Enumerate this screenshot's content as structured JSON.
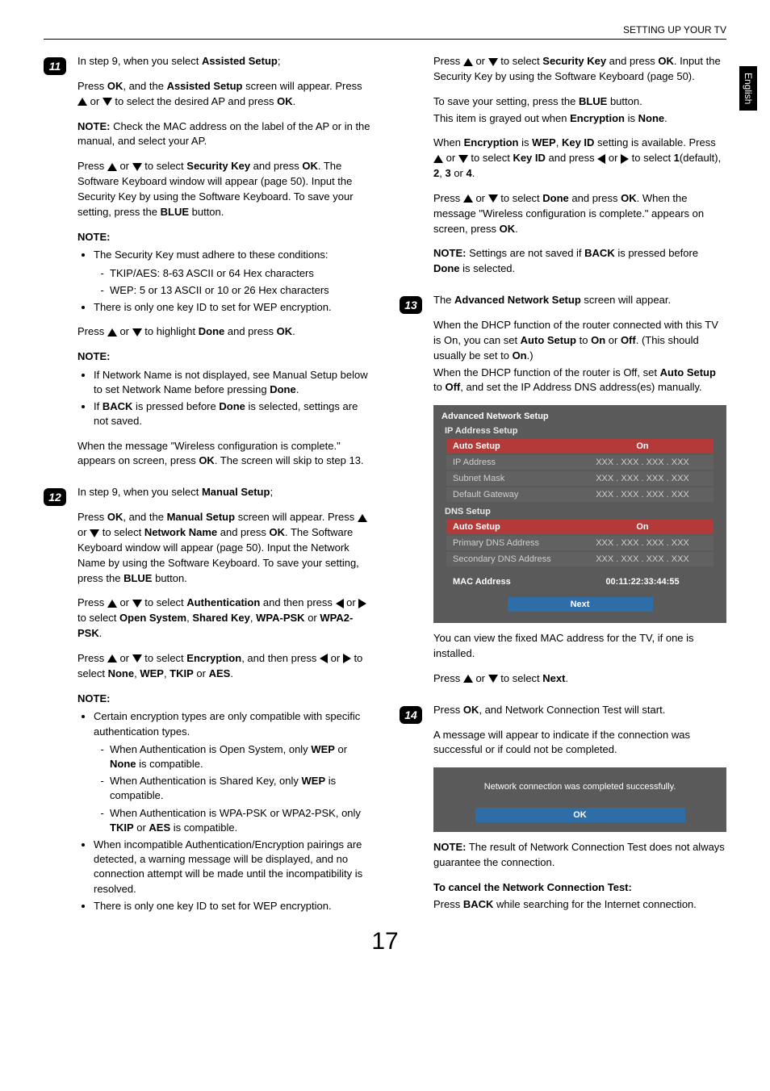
{
  "header": "SETTING UP YOUR TV",
  "sideTab": "English",
  "pageNumber": "17",
  "step11": {
    "badge": "11",
    "p1a": "In step 9, when you select ",
    "p1b": "Assisted Setup",
    "p1c": ";",
    "p2a": "Press ",
    "p2b": "OK",
    "p2c": ", and the ",
    "p2d": "Assisted Setup",
    "p2e": " screen will appear. Press ",
    "p2f": " or ",
    "p2g": " to select the desired AP and press ",
    "p2h": "OK",
    "p2i": ".",
    "p3a": "NOTE:",
    "p3b": " Check the MAC address on the label of the AP or in the manual, and select your AP.",
    "p4a": "Press ",
    "p4b": " or ",
    "p4c": " to select ",
    "p4d": "Security Key",
    "p4e": " and press ",
    "p4f": "OK",
    "p4g": ". The Software Keyboard window will appear (page 50). Input the Security Key by using the Software Keyboard. To save your setting, press the ",
    "p4h": "BLUE",
    "p4i": " button.",
    "note1": "NOTE:",
    "li1": "The Security Key must adhere to these conditions:",
    "li1a": "TKIP/AES: 8-63 ASCII or 64 Hex characters",
    "li1b": "WEP: 5 or 13 ASCII or 10 or 26 Hex characters",
    "li2": "There is only one key ID to set for WEP encryption.",
    "p5a": "Press ",
    "p5b": " or ",
    "p5c": " to highlight ",
    "p5d": "Done",
    "p5e": " and press ",
    "p5f": "OK",
    "p5g": ".",
    "note2": "NOTE:",
    "li3a": "If Network Name is not displayed, see Manual Setup below to set Network Name before pressing ",
    "li3b": "Done",
    "li3c": ".",
    "li4a": "If ",
    "li4b": "BACK",
    "li4c": " is pressed before ",
    "li4d": "Done",
    "li4e": " is selected, settings are not saved.",
    "p6a": "When the message \"Wireless configuration is complete.\" appears on screen, press ",
    "p6b": "OK",
    "p6c": ". The screen will skip to step 13."
  },
  "step12": {
    "badge": "12",
    "p1a": "In step 9, when you select ",
    "p1b": "Manual Setup",
    "p1c": ";",
    "p2a": "Press ",
    "p2b": "OK",
    "p2c": ", and the ",
    "p2d": "Manual Setup",
    "p2e": " screen will appear. Press ",
    "p2f": " or ",
    "p2g": " to select ",
    "p2h": "Network Name",
    "p2i": " and press ",
    "p2j": "OK",
    "p2k": ". The Software Keyboard window will appear (page 50). Input the Network Name by using the Software Keyboard. To save your setting, press the ",
    "p2l": "BLUE",
    "p2m": " button.",
    "p3a": "Press ",
    "p3b": " or ",
    "p3c": " to select ",
    "p3d": "Authentication",
    "p3e": " and then press ",
    "p3f": " or ",
    "p3g": " to select ",
    "p3h": "Open System",
    "p3i": ", ",
    "p3j": "Shared Key",
    "p3k": ", ",
    "p3l": "WPA-PSK",
    "p3m": " or ",
    "p3n": "WPA2-PSK",
    "p3o": ".",
    "p4a": "Press ",
    "p4b": " or ",
    "p4c": " to select ",
    "p4d": "Encryption",
    "p4e": ", and then press ",
    "p4f": " or ",
    "p4g": " to select ",
    "p4h": "None",
    "p4i": ", ",
    "p4j": "WEP",
    "p4k": ", ",
    "p4l": "TKIP",
    "p4m": " or ",
    "p4n": "AES",
    "p4o": ".",
    "note1": "NOTE:",
    "li1": "Certain encryption types are only compatible with specific authentication types.",
    "li1aA": "When Authentication is Open System, only ",
    "li1aB": "WEP",
    "li1aC": " or ",
    "li1aD": "None",
    "li1aE": " is compatible.",
    "li1bA": "When Authentication is Shared Key, only ",
    "li1bB": "WEP",
    "li1bC": " is compatible.",
    "li1cA": "When Authentication is WPA-PSK or WPA2-PSK, only ",
    "li1cB": "TKIP",
    "li1cC": " or ",
    "li1cD": "AES",
    "li1cE": " is compatible.",
    "li2": "When incompatible Authentication/Encryption pairings are detected, a warning message will be displayed, and no connection attempt will be made until the incompatibility is resolved.",
    "li3": "There is only one key ID to set for WEP encryption."
  },
  "col2top": {
    "p1a": "Press ",
    "p1b": " or ",
    "p1c": " to select ",
    "p1d": "Security Key",
    "p1e": " and press ",
    "p1f": "OK",
    "p1g": ". Input the Security Key by using the Software Keyboard (page 50).",
    "p2a": "To save your setting, press the ",
    "p2b": "BLUE",
    "p2c": " button.",
    "p3a": "This item is grayed out when ",
    "p3b": "Encryption",
    "p3c": " is ",
    "p3d": "None",
    "p3e": ".",
    "p4a": "When ",
    "p4b": "Encryption",
    "p4c": " is ",
    "p4d": "WEP",
    "p4e": ", ",
    "p4f": "Key ID",
    "p4g": " setting is available. Press ",
    "p4h": " or ",
    "p4i": " to select ",
    "p4j": "Key ID",
    "p4k": " and press ",
    "p4l": " or ",
    "p4m": " to select ",
    "p4n": "1",
    "p4o": "(default), ",
    "p4p": "2",
    "p4q": ", ",
    "p4r": "3",
    "p4s": " or ",
    "p4t": "4",
    "p4u": ".",
    "p5a": "Press ",
    "p5b": " or ",
    "p5c": " to select ",
    "p5d": "Done",
    "p5e": " and press ",
    "p5f": "OK",
    "p5g": ". When the message \"Wireless configuration is complete.\" appears on screen, press ",
    "p5h": "OK",
    "p5i": ".",
    "p6a": "NOTE:",
    "p6b": " Settings are not saved if ",
    "p6c": "BACK",
    "p6d": " is pressed before ",
    "p6e": "Done",
    "p6f": " is selected."
  },
  "step13": {
    "badge": "13",
    "p1a": "The ",
    "p1b": "Advanced Network Setup",
    "p1c": " screen will appear.",
    "p2a": "When the DHCP function of the router connected with this TV is On, you can set ",
    "p2b": "Auto Setup",
    "p2c": " to ",
    "p2d": "On",
    "p2e": " or ",
    "p2f": "Off",
    "p2g": ". (This should usually be set to ",
    "p2h": "On",
    "p2i": ".)",
    "p3a": "When the DHCP function of the router is Off, set ",
    "p3b": "Auto Setup",
    "p3c": " to ",
    "p3d": "Off",
    "p3e": ", and set the IP Address DNS address(es) manually.",
    "panel": {
      "title": "Advanced Network Setup",
      "sub1": "IP Address Setup",
      "r1k": "Auto Setup",
      "r1v": "On",
      "r2k": "IP Address",
      "r2v": "XXX . XXX . XXX . XXX",
      "r3k": "Subnet Mask",
      "r3v": "XXX . XXX . XXX . XXX",
      "r4k": "Default Gateway",
      "r4v": "XXX . XXX . XXX . XXX",
      "sub2": "DNS Setup",
      "r5k": "Auto Setup",
      "r5v": "On",
      "r6k": "Primary DNS Address",
      "r6v": "XXX . XXX . XXX . XXX",
      "r7k": "Secondary DNS Address",
      "r7v": "XXX . XXX . XXX . XXX",
      "r8k": "MAC Address",
      "r8v": "00:11:22:33:44:55",
      "next": "Next"
    },
    "p4": "You can view the fixed MAC address for the TV, if one is installed.",
    "p5a": "Press ",
    "p5b": " or ",
    "p5c": " to select ",
    "p5d": "Next",
    "p5e": "."
  },
  "step14": {
    "badge": "14",
    "p1a": "Press ",
    "p1b": "OK",
    "p1c": ", and Network Connection Test will start.",
    "p2": "A message will appear to indicate if the connection was successful or if could not be completed.",
    "dialog": {
      "msg": "Network connection was completed successfully.",
      "ok": "OK"
    },
    "p3a": "NOTE:",
    "p3b": " The result of Network Connection Test does not always guarantee the connection.",
    "p4": "To cancel the Network Connection Test:",
    "p5a": "Press ",
    "p5b": "BACK",
    "p5c": " while searching for the Internet connection."
  }
}
